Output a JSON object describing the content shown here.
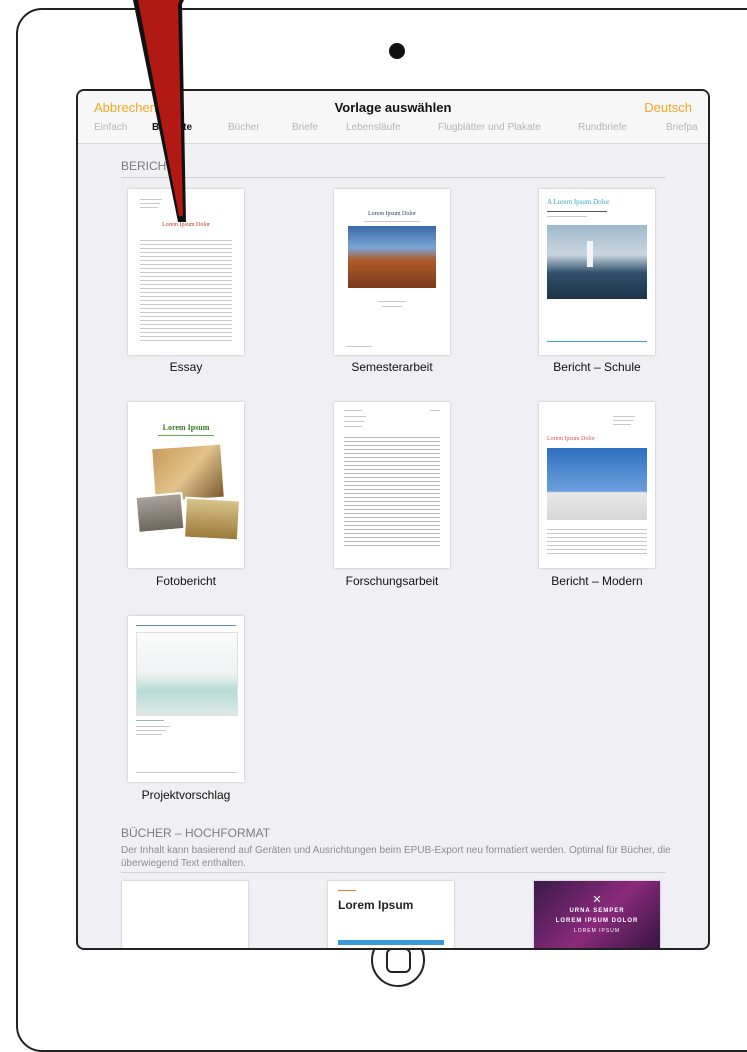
{
  "nav": {
    "cancel": "Abbrechen",
    "title": "Vorlage auswählen",
    "language": "Deutsch"
  },
  "tabs": [
    "Einfach",
    "Berichte",
    "Bücher",
    "Briefe",
    "Lebensläufe",
    "Flugblätter und Plakate",
    "Rundbriefe",
    "Briefpa"
  ],
  "sections": {
    "reports": "BERICHTE",
    "books": "BÜCHER – HOCHFORMAT",
    "books_desc": "Der Inhalt kann basierend auf Geräten und Ausrichtungen beim EPUB-Export neu formatiert werden. Optimal für Bücher, die überwiegend Text enthalten."
  },
  "templates": [
    {
      "name": "Essay",
      "thumb_title": "Lorem Ipsum Dolor"
    },
    {
      "name": "Semesterarbeit",
      "thumb_title": "Lorem Ipsum Dolor"
    },
    {
      "name": "Bericht – Schule",
      "thumb_title": "A Lorem Ipsum Dolor"
    },
    {
      "name": "Fotobericht",
      "thumb_title": "Lorem Ipsum"
    },
    {
      "name": "Forschungsarbeit",
      "thumb_title": ""
    },
    {
      "name": "Bericht – Modern",
      "thumb_title": "Lorem Ipsum Dolor"
    },
    {
      "name": "Projektvorschlag",
      "thumb_title": ""
    }
  ],
  "book_thumbs": {
    "second_title": "Lorem Ipsum",
    "third_line1": "URNA SEMPER",
    "third_line2": "LOREM IPSUM DOLOR",
    "third_line3": "LOREM IPSUM"
  },
  "colors": {
    "accent": "#f5a623",
    "essay_title": "#c0392b",
    "photo_report_title": "#3a7a2a",
    "school_title": "#3aa6c4",
    "modern_title": "#d9534f"
  }
}
